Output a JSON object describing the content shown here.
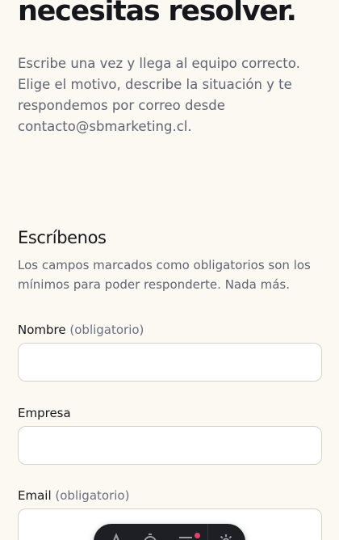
{
  "hero": {
    "title": "necesitas resolver.",
    "description": "Escribe una vez y llega al equipo correcto. Elige el motivo, describe la situación y te respondemos por correo desde contacto@sbmarketing.cl."
  },
  "form": {
    "title": "Escríbenos",
    "description": "Los campos marcados como obligatorios son los mínimos para poder responderte. Nada más.",
    "fields": {
      "nombre": {
        "label": "Nombre",
        "hint": "(obligatorio)",
        "value": ""
      },
      "empresa": {
        "label": "Empresa",
        "value": ""
      },
      "email": {
        "label": "Email",
        "hint": "(obligatorio)",
        "value": ""
      }
    }
  },
  "toolbar": {
    "icons": [
      "text-icon",
      "timer-icon",
      "menu-icon",
      "gear-icon"
    ],
    "notification_color": "#e0426b",
    "background": "#1e1f24"
  }
}
